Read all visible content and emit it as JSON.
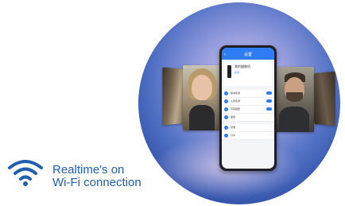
{
  "caption": {
    "line1": "Realtime's on",
    "line2": "Wi-Fi connection"
  },
  "icons": {
    "wifi": "wifi-icon",
    "back": "back-arrow-icon",
    "camera": "camera-device-icon",
    "chevron": "chevron-right-icon"
  },
  "colors": {
    "brand_blue": "#1f5fae",
    "app_blue": "#2f7df5",
    "circle_dark": "#283f8e",
    "circle_light": "#d8c9ee"
  },
  "phone": {
    "title": "设置",
    "device_name": "我的摄像机",
    "device_status": "在线",
    "rows_group1": [
      {
        "label": "移动侦测",
        "control": "toggle"
      },
      {
        "label": "人形侦测",
        "control": "toggle"
      },
      {
        "label": "声音报警",
        "control": "toggle"
      },
      {
        "label": "夜视",
        "control": "chevron"
      }
    ],
    "rows_group2": [
      {
        "label": "存储",
        "control": "chevron"
      },
      {
        "label": "分享",
        "control": "chevron"
      }
    ]
  }
}
